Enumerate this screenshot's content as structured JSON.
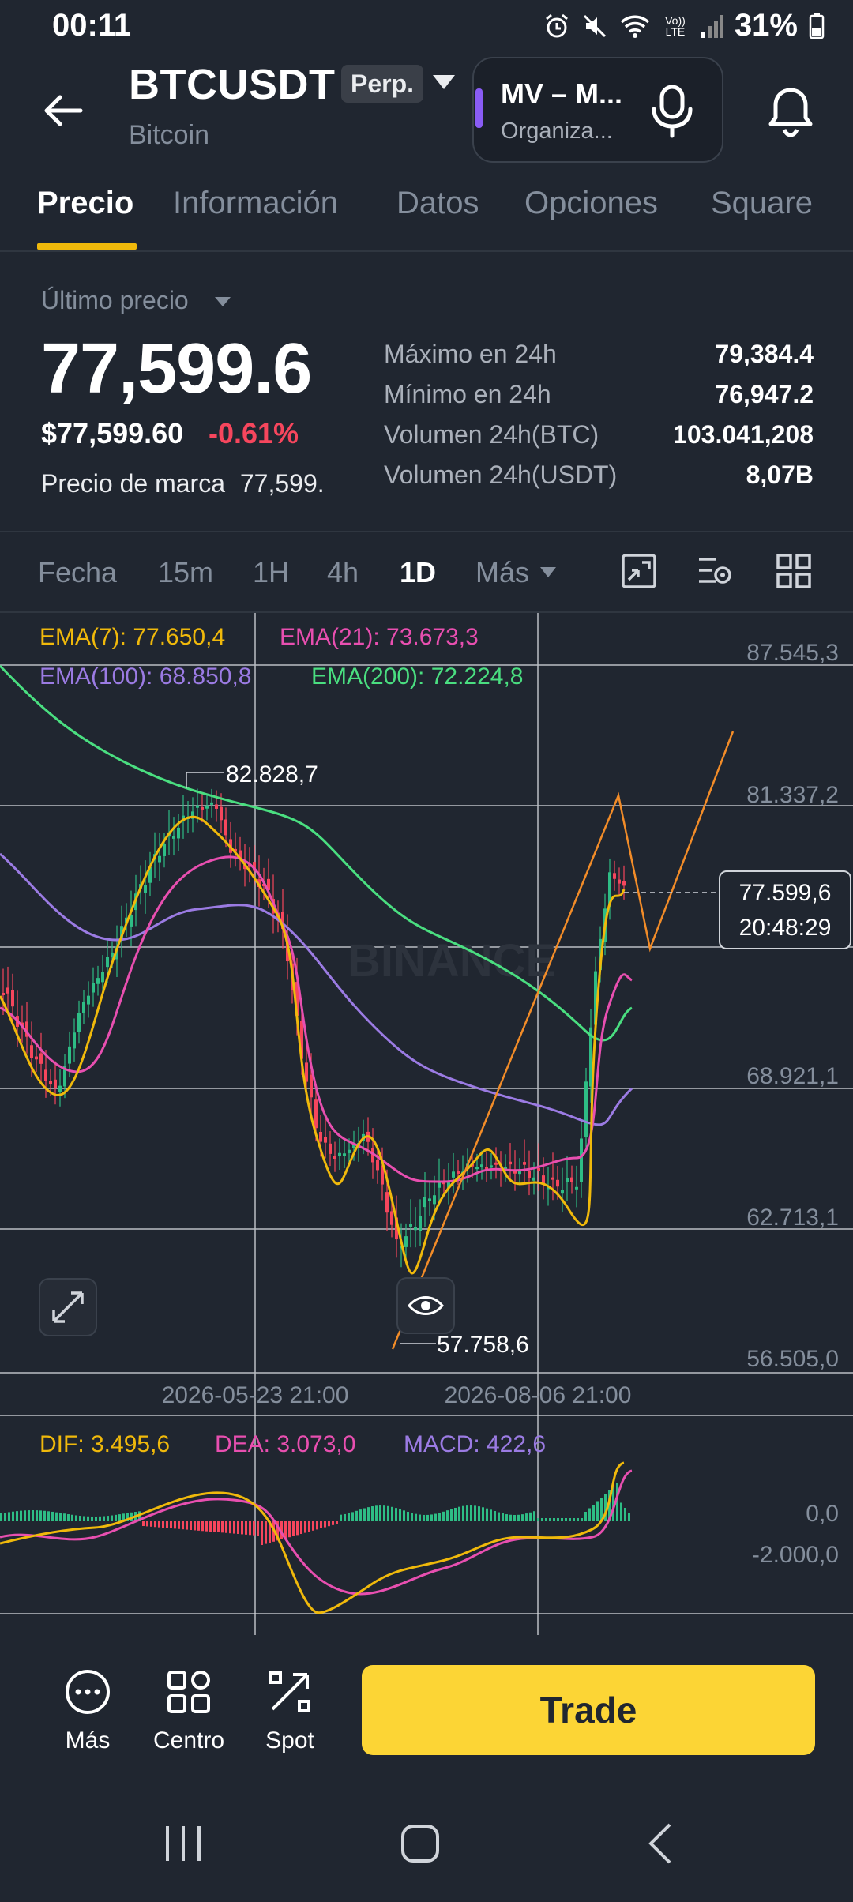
{
  "status_bar": {
    "time": "00:11",
    "battery": "31%",
    "signal_label": "Vo)) LTE"
  },
  "header": {
    "symbol": "BTCUSDT",
    "badge": "Perp.",
    "name": "Bitcoin",
    "live_title": "MV – M...",
    "live_subtitle": "Organiza..."
  },
  "tabs": [
    "Precio",
    "Información",
    "Datos",
    "Opciones",
    "Square"
  ],
  "price": {
    "label": "Último precio",
    "last": "77,599.6",
    "usd": "$77,599.60",
    "change": "-0.61%",
    "mark_label": "Precio de marca",
    "mark_value": "77,599."
  },
  "stats": [
    {
      "label": "Máximo en 24h",
      "value": "79,384.4"
    },
    {
      "label": "Mínimo en 24h",
      "value": "76,947.2"
    },
    {
      "label": "Volumen 24h(BTC)",
      "value": "103.041,208"
    },
    {
      "label": "Volumen 24h(USDT)",
      "value": "8,07B"
    }
  ],
  "timeframes": {
    "date_label": "Fecha",
    "items": [
      "15m",
      "1H",
      "4h",
      "1D"
    ],
    "active": "1D",
    "more": "Más"
  },
  "chart": {
    "ema_labels": [
      "EMA(7): 77.650,4",
      "EMA(21): 73.673,3",
      "EMA(100): 68.850,8",
      "EMA(200): 72.224,8"
    ],
    "ema_colors": [
      "#f0b90b",
      "#e84fb0",
      "#9b7be3",
      "#4ade80"
    ],
    "y_ticks": [
      "87.545,3",
      "81.337,2",
      "68.921,1",
      "62.713,1",
      "56.505,0"
    ],
    "high_label": "82.828,7",
    "low_label": "57.758,6",
    "current_price": "77.599,6",
    "countdown": "20:48:29",
    "x_labels": [
      "2026-05-23 21:00",
      "2026-08-06 21:00"
    ],
    "watermark": "BINANCE",
    "macd_labels": [
      "DIF: 3.495,6",
      "DEA: 3.073,0",
      "MACD: 422,6"
    ],
    "macd_y_ticks": [
      "0,0",
      "-2.000,0"
    ]
  },
  "chart_data": {
    "type": "line",
    "title": "BTCUSDT 1D",
    "y_range": [
      56505.0,
      87545.3
    ],
    "series": [
      {
        "name": "EMA(7)",
        "last": 77650.4
      },
      {
        "name": "EMA(21)",
        "last": 73673.3
      },
      {
        "name": "EMA(100)",
        "last": 68850.8
      },
      {
        "name": "EMA(200)",
        "last": 72224.8
      }
    ],
    "high": 82828.7,
    "low": 57758.6,
    "current": 77599.6,
    "macd": {
      "DIF": 3495.6,
      "DEA": 3073.0,
      "MACD": 422.6
    }
  },
  "bottom_bar": {
    "items": [
      "Más",
      "Centro",
      "Spot"
    ],
    "trade_label": "Trade"
  }
}
